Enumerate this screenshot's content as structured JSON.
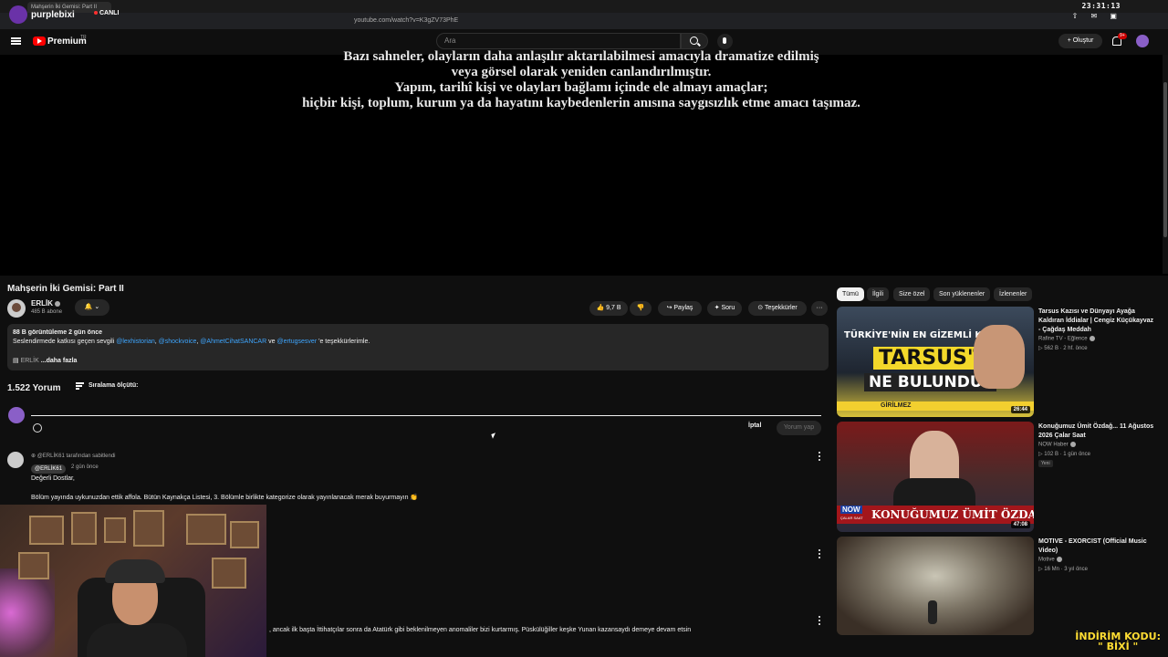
{
  "browser": {
    "tab_title": "Mahşerin İki Gemisi: Part II",
    "url": "youtube.com/watch?v=K3gZV73PhE",
    "clock": "23:31:13",
    "clock_icons": "⇧ ✉ ▣"
  },
  "stream": {
    "brand": "purplebixi",
    "live_label": "CANLI"
  },
  "header": {
    "logo_label": "Premium",
    "region": "TR",
    "search_placeholder": "Ara",
    "create_label": "+ Oluştur",
    "notif_badge": "9+"
  },
  "video": {
    "overlay_lines": [
      "Bazı sahneler, olayların daha anlaşılır aktarılabilmesi amacıyla dramatize edilmiş",
      "veya görsel olarak yeniden canlandırılmıştır.",
      "Yapım, tarihî kişi ve olayları bağlamı içinde ele almayı amaçlar;",
      "hiçbir kişi, toplum, kurum ya da hayatını kaybedenlerin anısına saygısızlık etme amacı taşımaz."
    ]
  },
  "meta": {
    "title": "Mahşerin İki Gemisi: Part II",
    "channel": "ERLİK",
    "subscribers": "485 B abone",
    "likes": "9,7 B",
    "share": "Paylaş",
    "ask": "Soru",
    "thanks": "Teşekkürler"
  },
  "description": {
    "stats": "88 B görüntüleme  2 gün önce",
    "line_prefix": "Seslendirmede katkısı geçen sevgili",
    "mentions": [
      "@lexhistorian",
      "@shockvoice",
      "@AhmetCihatSANCAR",
      "@ertugsesver"
    ],
    "sep1": ",",
    "sep_and": "ve",
    "line_suffix": "'e teşekkürlerimle.",
    "channel_tag": "ERLİK",
    "more": "...daha fazla"
  },
  "comments": {
    "count": "1.522 Yorum",
    "sort_label": "Sıralama ölçütü:",
    "cancel": "İptal",
    "submit": "Yorum yap",
    "pinned": {
      "pinned_by": "@ERLİK61 tarafından sabitlendi",
      "author": "@ERLİK61",
      "time": "2 gün önce",
      "greeting": "Değerli Dostlar,",
      "body": "Bölüm yayında uykunuzdan ettik affola. Bütün Kaynakça Listesi, 3. Bölümle birlikte kategorize olarak yayınlanacak merak buyurmayın 👏"
    },
    "partial_text": ", ancak ilk başta İttihatçılar sonra da Atatürk gibi beklenilmeyen anomaliler bizi kurtarmış. Püskülüğiller keşke Yunan kazansaydı demeye devam etsin"
  },
  "sidebar": {
    "chips": [
      "Tümü",
      "İlgili",
      "Size özel",
      "Son yüklenenler",
      "İzlenenler"
    ],
    "videos": [
      {
        "title": "Tarsus Kazısı ve Dünyayı Ayağa Kaldıran İddialar | Cengiz Küçükayvaz - Çağdaş Meddah",
        "channel": "Rafine TV - Eğlence",
        "meta": "▷ 562 B · 2 hf. önce",
        "duration": "26:44",
        "thumb_line1": "TÜRKİYE'NİN EN GİZEMLİ KAZISI:",
        "thumb_line2": "TARSUS'TA",
        "thumb_line3": "NE BULUNDU?",
        "thumb_tape": "GİRİLMEZ"
      },
      {
        "title": "Konuğumuz Ümit Özdağ... 11 Ağustos 2026 Çalar Saat",
        "channel": "NOW Haber",
        "meta": "▷ 102 B · 1 gün önce",
        "badge": "Yeni",
        "duration": "47:08",
        "thumb_line1": "KONUĞUMUZ ÜMİT ÖZDAĞ...",
        "thumb_logo": "NOW",
        "thumb_logo_sub": "ÇALAR SAAT"
      },
      {
        "title": "MOTIVE - EXORCIST (Official Music Video)",
        "channel": "Motive",
        "meta": "▷ 16 Mn · 3 yıl önce"
      }
    ]
  },
  "promo": {
    "line1": "İNDİRİM KODU:",
    "line2": "\" BİXİ \""
  }
}
